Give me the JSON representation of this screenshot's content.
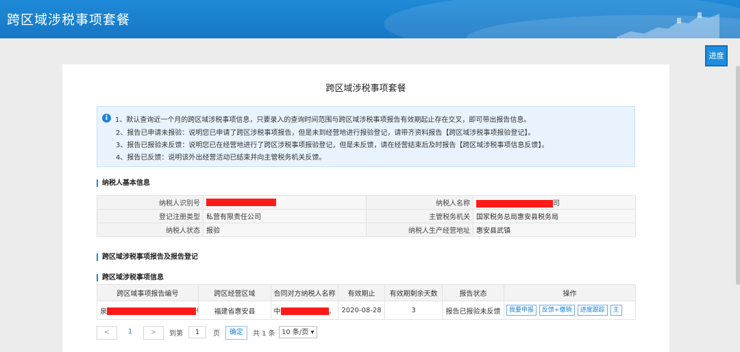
{
  "header": {
    "title": "跨区域涉税事项套餐"
  },
  "progress_button": "进度",
  "page_title": "跨区域涉税事项套餐",
  "notice": [
    "1、默认查询近一个月的跨区域涉税事项信息，只要录入的查询时间范围与跨区域涉税事项报告有效期起止存在交叉，即可带出报告信息。",
    "2、报告已申请未报验：说明您已申请了跨区涉税事项报告，但是未到经营地进行报验登记，请带齐资料报告【跨区域涉税事项报验登记】。",
    "3、报告已报验未反馈：说明您已在经营地进行了跨区涉税事项报验登记，但是未反馈，请在经营结束后及时报告【跨区域涉税事项信息反馈】。",
    "4、报告已反馈：说明该外出经营活动已结束并向主管税务机关反馈。"
  ],
  "sections": {
    "basic": "纳税人基本信息",
    "report": "跨区域涉税事项报告及报告登记",
    "items": "跨区域涉税事项信息"
  },
  "basic_info": {
    "taxpayer_id_label": "纳税人识别号",
    "taxpayer_name_label": "纳税人名称",
    "taxpayer_name_suffix": "司",
    "reg_type_label": "登记注册类型",
    "reg_type_value": "私营有限责任公司",
    "tax_office_label": "主管税务机关",
    "tax_office_value": "国家税务总局惠安县税务局",
    "status_label": "纳税人状态",
    "status_value": "报验",
    "address_label": "纳税人生产经营地址",
    "address_value": "惠安县武镇"
  },
  "table": {
    "headers": [
      "跨区域事项报告编号",
      "跨区经营区域",
      "合同对方纳税人名称",
      "有效期止",
      "有效期剩余天数",
      "报告状态",
      "操作"
    ],
    "row": {
      "report_no_prefix": "泉",
      "report_no_suffix": "号",
      "region": "福建省惠安县",
      "counterparty_prefix": "中",
      "counterparty_suffix": "。",
      "valid_to": "2020-08-28",
      "days_left": "3",
      "status": "报告已报验未反馈",
      "actions": [
        "我要申报",
        "反馈+缴销",
        "进度跟踪",
        "主"
      ]
    }
  },
  "pager": {
    "prev": "<",
    "page": "1",
    "next": ">",
    "goto_label": "到第",
    "goto_value": "1",
    "page_unit": "页",
    "confirm": "确定",
    "total": "共 1 条",
    "per_page": "10 条/页 ▾"
  }
}
